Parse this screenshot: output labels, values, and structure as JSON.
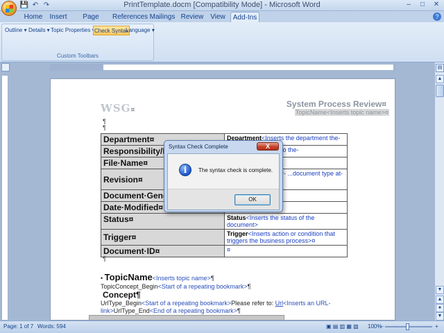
{
  "window": {
    "title": "PrintTemplate.docm [Compatibility Mode] - Microsoft Word",
    "controls": [
      "–",
      "□",
      "✕"
    ]
  },
  "quick_access": [
    "💾",
    "↶",
    "↷"
  ],
  "tabs": [
    "Home",
    "Insert",
    "Page Layout",
    "References",
    "Mailings",
    "Review",
    "View",
    "Add-Ins"
  ],
  "active_tab": "Add-Ins",
  "ribbon": {
    "toolbar_items": [
      "Outline ▾",
      "Details ▾",
      "Topic Properties ▾",
      "Check Syntax",
      "Language ▾"
    ],
    "active_item": "Check Syntax",
    "group_label": "Custom Toolbars"
  },
  "document": {
    "logo": "WSG",
    "logo_mark": "¤",
    "title": "System Process Review¤",
    "topic_field": "TopicName<Inserts topic name>¤",
    "table": [
      {
        "label": "Department¤",
        "value_bold": "Department",
        "value": "<Inserts the department the-"
      },
      {
        "label": "Responsibility/I",
        "value_bold": "",
        "value": "...of roles assigned to the-"
      },
      {
        "label": "File·Name¤",
        "value_bold": "",
        "value": "¤"
      },
      {
        "label": "Revision¤",
        "value_bold": "",
        "value": "...rts version number-  ...document type at-"
      },
      {
        "label": "Document·Gene",
        "value_bold": "",
        "value": "¤"
      },
      {
        "label": "Date·Modified¤",
        "value_bold": "",
        "value": "¤"
      },
      {
        "label": "Status¤",
        "value_bold": "Status",
        "value": "<Inserts the status of the document>"
      },
      {
        "label": "Trigger¤",
        "value_bold": "Trigger",
        "value": "<Inserts action or condition that triggers the business process>¤"
      },
      {
        "label": "Document·ID¤",
        "value_bold": "",
        "value": "¤"
      }
    ],
    "topicname_line": {
      "bold": "TopicName",
      "blue": "<Inserts topic name>",
      "end": "¶"
    },
    "concept_begin": {
      "text": "TopicConcept_Begin",
      "blue": "<Start of a repeating bookmark>",
      "end": "¶"
    },
    "concept_heading": "Concept¶",
    "url_line1": {
      "text": "UrlType_Begin",
      "blue": "<Start of a repeating bookmark>",
      "rest": "Please refer to: ",
      "url": "Url",
      "url_blue": "<Inserts an URL-"
    },
    "url_line2": {
      "blue_start": "link>",
      "text": "UrlType_End",
      "blue": "<End of a repeating bookmark>",
      "end": "¶"
    }
  },
  "status_bar": {
    "page": "Page: 1 of 7",
    "words": "Words: 594",
    "zoom": "100%",
    "zoom_minus": "–",
    "zoom_plus": "+"
  },
  "dialog": {
    "title": "Syntax Check Complete",
    "message": "The syntax check is complete.",
    "ok_label": "OK",
    "close_label": "X",
    "icon": "info-icon"
  }
}
